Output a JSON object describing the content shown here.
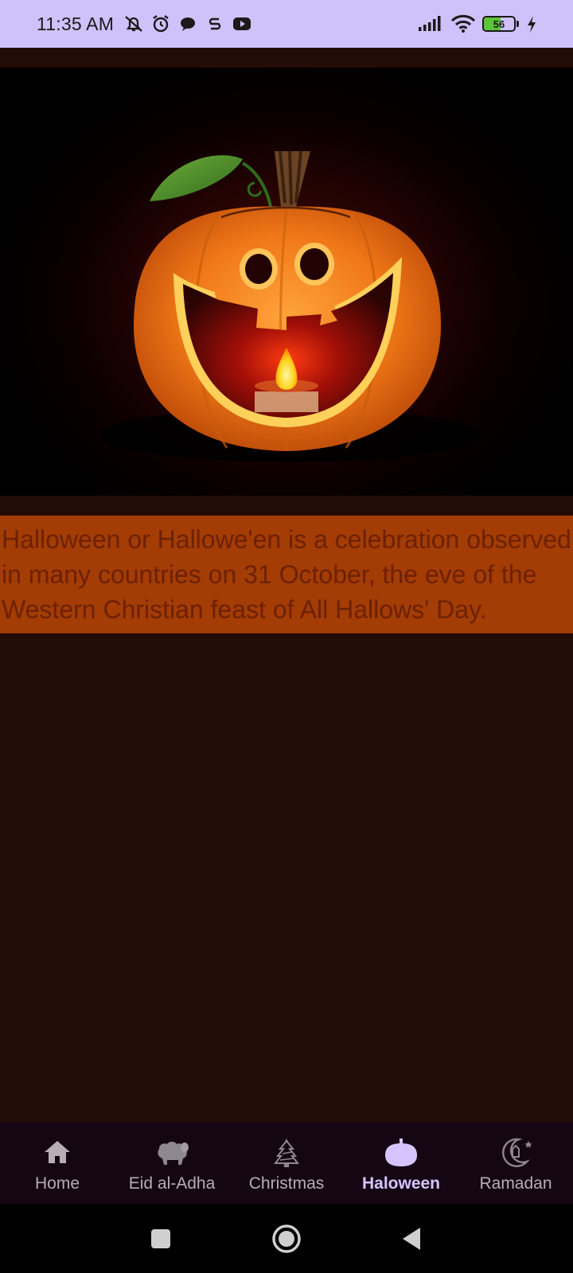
{
  "status_bar": {
    "time": "11:35 AM",
    "battery_level": "56",
    "battery_fraction": 0.56,
    "left_icons": [
      "muted-bell-icon",
      "alarm-icon",
      "chat-icon",
      "s-icon",
      "youtube-icon"
    ],
    "right_icons": [
      "signal-icon",
      "wifi-icon",
      "battery-icon",
      "charging-icon"
    ]
  },
  "hero": {
    "subject": "jack-o-lantern-icon"
  },
  "content": {
    "description": "Halloween or Hallowe'en is a celebration observed in many countries on 31 October, the eve of the Western Christian feast of All Hallows' Day."
  },
  "bottom_nav": {
    "items": [
      {
        "label": "Home",
        "icon": "home-icon"
      },
      {
        "label": "Eid al-Adha",
        "icon": "sheep-icon"
      },
      {
        "label": "Christmas",
        "icon": "christmas-tree-icon"
      },
      {
        "label": "Haloween",
        "icon": "pumpkin-icon",
        "active": true
      },
      {
        "label": "Ramadan",
        "icon": "crescent-lantern-icon"
      }
    ]
  },
  "system_nav": {
    "buttons": [
      "recents-button",
      "home-button",
      "back-button"
    ]
  },
  "colors": {
    "status_bar_bg": "#cfc1fa",
    "page_bg": "#230b08",
    "description_bg": "#a33c05",
    "description_text": "#6d2102",
    "nav_bg": "#140612",
    "nav_active": "#d7c4ff"
  }
}
